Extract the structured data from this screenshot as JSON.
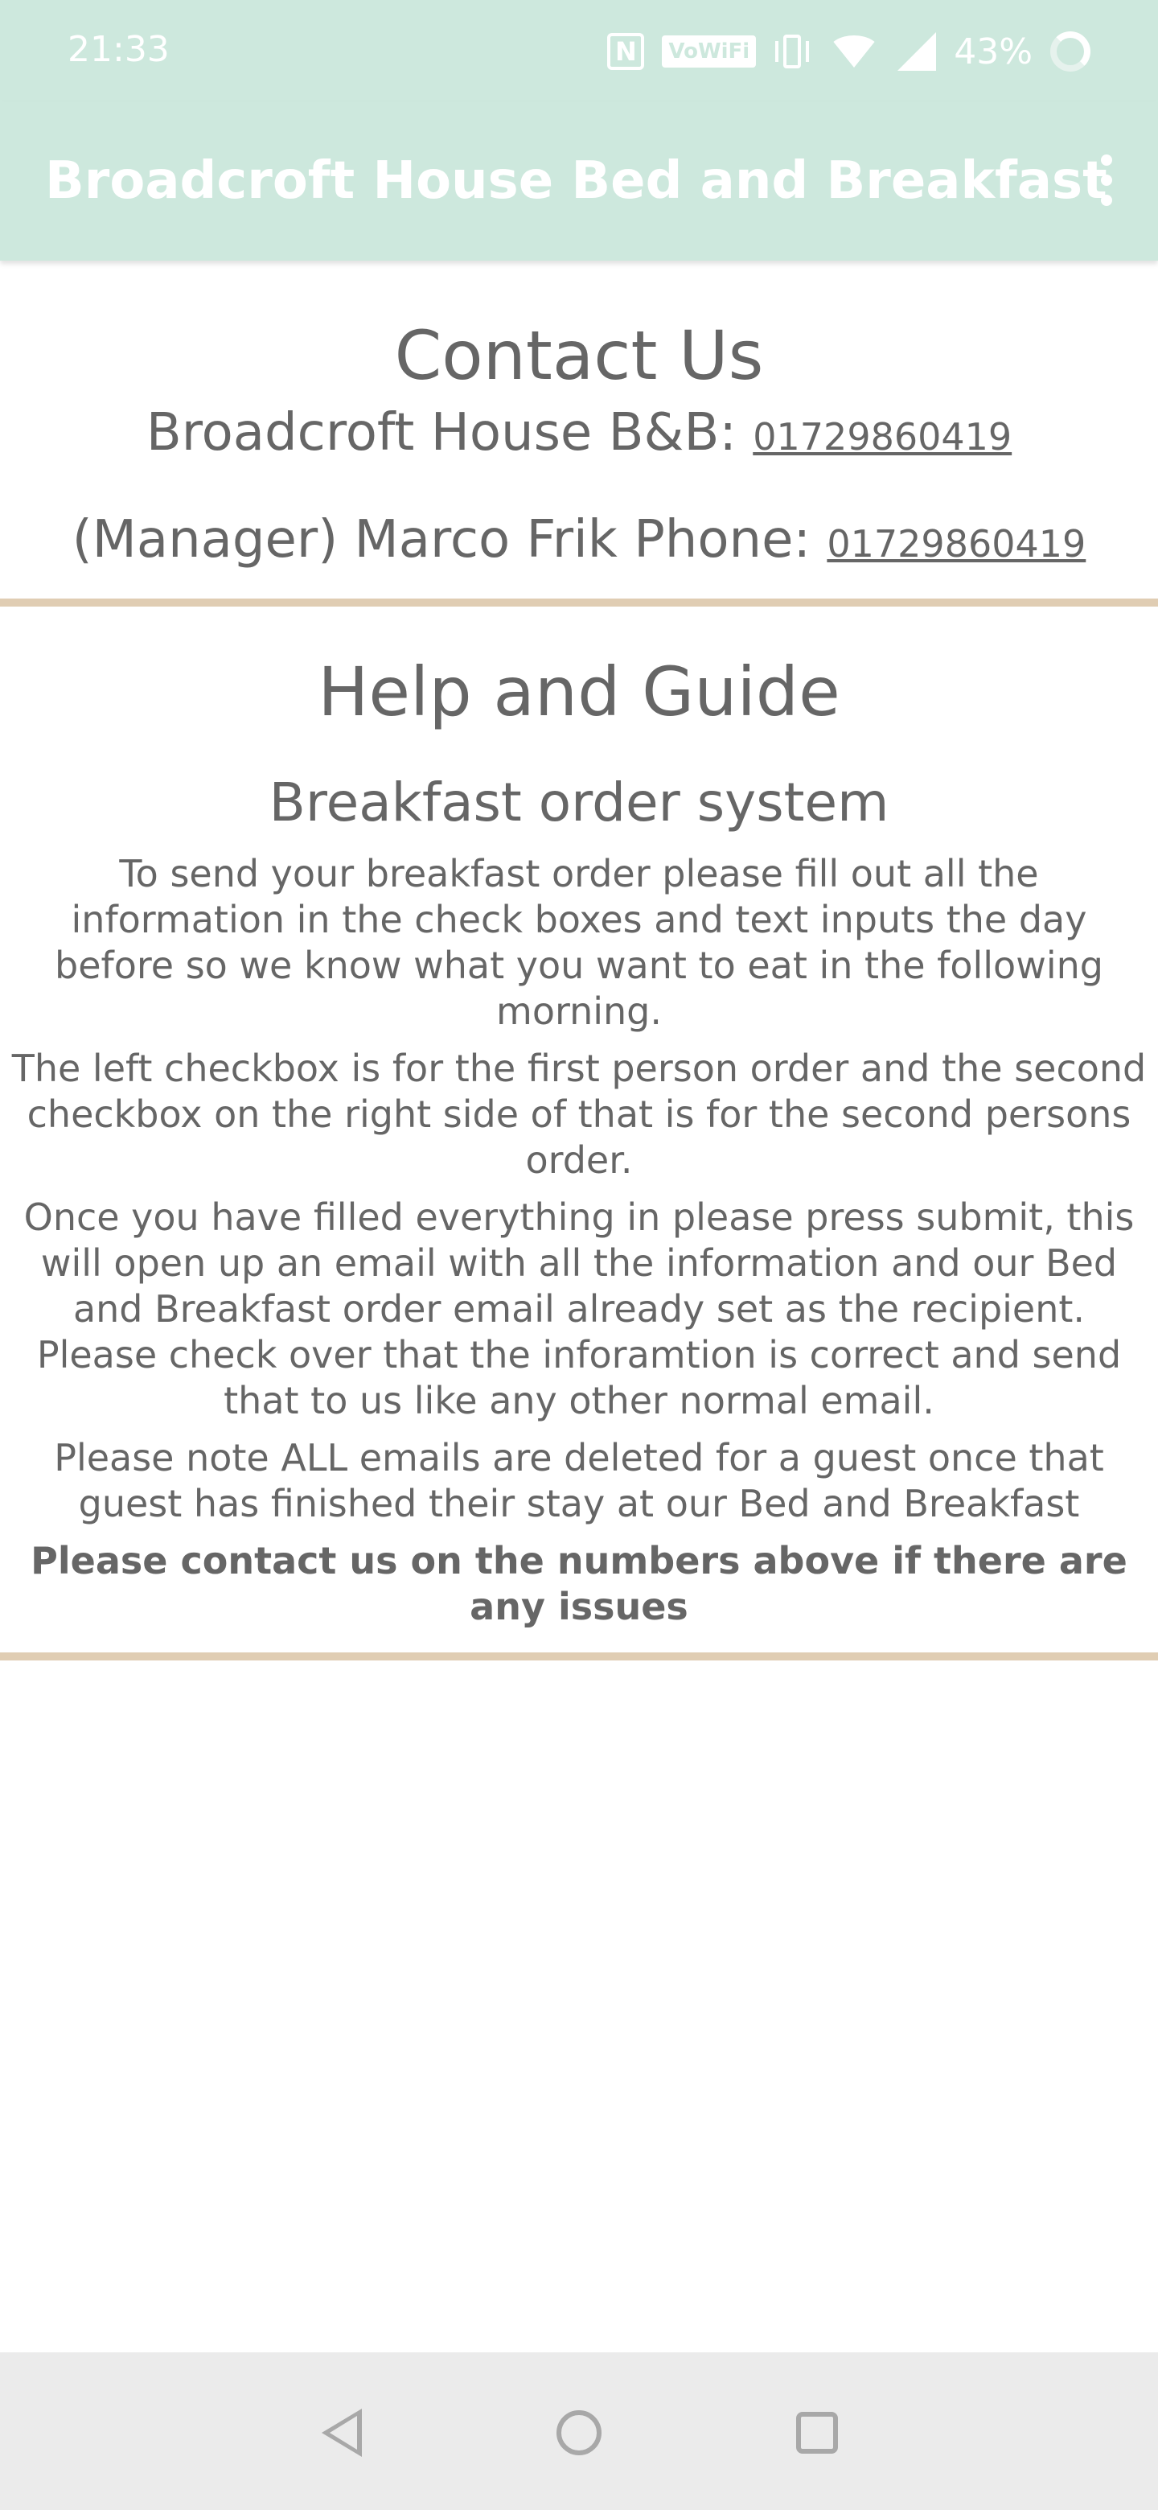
{
  "status_bar": {
    "time": "21:33",
    "icons": [
      "nfc-icon",
      "vowifi-icon",
      "vibrate-icon",
      "wifi-icon",
      "signal-icon",
      "battery-icon"
    ],
    "vowifi_label": "VoWiFi",
    "battery": "43%"
  },
  "app_bar": {
    "title": "Broadcroft House Bed and Breakfast",
    "menu_icon": "more-vert-icon"
  },
  "contact": {
    "title": "Contact Us",
    "line1_label": "Broadcroft House B&B:",
    "line1_phone": "01729860419",
    "line2_label": "(Manager) Marco Frik Phone:",
    "line2_phone": "01729860419"
  },
  "help": {
    "title": "Help and Guide",
    "subtitle": "Breakfast order system",
    "paragraphs": [
      "To send your breakfast order please fill out all the information in the check boxes and text inputs the day before so we know what you want to eat in the following morning.",
      "The left checkbox is for the first person order and the second checkbox on the right side of that is for the second persons order.",
      "Once you have filled everything in please press submit, this will open up an email with all the information and our Bed and Breakfast order email already set as the recipient. Please check over that the inforamtion is correct and send that to us like any other normal email.",
      "Please note ALL emails are deleted for a guest once that guest has finished their stay at our Bed and Breakfast"
    ],
    "note": "Please contact us on the numbers above if there are any issues"
  },
  "colors": {
    "app_bar": "#cde8dd",
    "divider": "#e0cdb3",
    "text": "#666666",
    "nav_bar": "#ebebeb"
  },
  "nav_bar": {
    "icons": [
      "back-icon",
      "home-icon",
      "recents-icon"
    ]
  }
}
